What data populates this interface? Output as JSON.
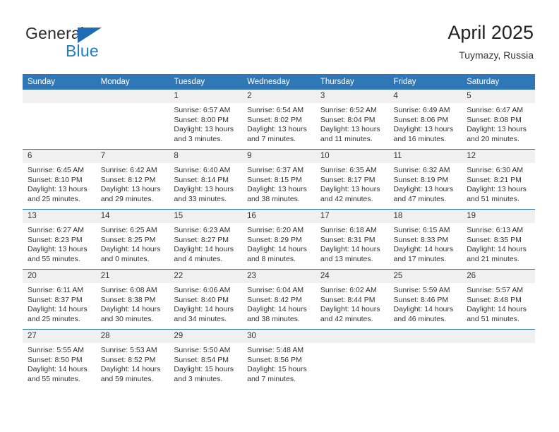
{
  "brand": {
    "name_top": "General",
    "name_bottom": "Blue",
    "triangle_icon": "blue-triangle-logo-mark",
    "accent_color": "#1f7ec4",
    "mark_color": "#1e6cb5"
  },
  "header": {
    "title": "April 2025",
    "subtitle": "Tuymazy, Russia"
  },
  "colors": {
    "header_blue": "#3077b8",
    "daynum_band": "#f0f0f0",
    "text": "#333333"
  },
  "weekday_headers": [
    "Sunday",
    "Monday",
    "Tuesday",
    "Wednesday",
    "Thursday",
    "Friday",
    "Saturday"
  ],
  "weeks": [
    [
      {
        "day": "",
        "lines": []
      },
      {
        "day": "",
        "lines": []
      },
      {
        "day": "1",
        "lines": [
          "Sunrise: 6:57 AM",
          "Sunset: 8:00 PM",
          "Daylight: 13 hours",
          "and 3 minutes."
        ]
      },
      {
        "day": "2",
        "lines": [
          "Sunrise: 6:54 AM",
          "Sunset: 8:02 PM",
          "Daylight: 13 hours",
          "and 7 minutes."
        ]
      },
      {
        "day": "3",
        "lines": [
          "Sunrise: 6:52 AM",
          "Sunset: 8:04 PM",
          "Daylight: 13 hours",
          "and 11 minutes."
        ]
      },
      {
        "day": "4",
        "lines": [
          "Sunrise: 6:49 AM",
          "Sunset: 8:06 PM",
          "Daylight: 13 hours",
          "and 16 minutes."
        ]
      },
      {
        "day": "5",
        "lines": [
          "Sunrise: 6:47 AM",
          "Sunset: 8:08 PM",
          "Daylight: 13 hours",
          "and 20 minutes."
        ]
      }
    ],
    [
      {
        "day": "6",
        "lines": [
          "Sunrise: 6:45 AM",
          "Sunset: 8:10 PM",
          "Daylight: 13 hours",
          "and 25 minutes."
        ]
      },
      {
        "day": "7",
        "lines": [
          "Sunrise: 6:42 AM",
          "Sunset: 8:12 PM",
          "Daylight: 13 hours",
          "and 29 minutes."
        ]
      },
      {
        "day": "8",
        "lines": [
          "Sunrise: 6:40 AM",
          "Sunset: 8:14 PM",
          "Daylight: 13 hours",
          "and 33 minutes."
        ]
      },
      {
        "day": "9",
        "lines": [
          "Sunrise: 6:37 AM",
          "Sunset: 8:15 PM",
          "Daylight: 13 hours",
          "and 38 minutes."
        ]
      },
      {
        "day": "10",
        "lines": [
          "Sunrise: 6:35 AM",
          "Sunset: 8:17 PM",
          "Daylight: 13 hours",
          "and 42 minutes."
        ]
      },
      {
        "day": "11",
        "lines": [
          "Sunrise: 6:32 AM",
          "Sunset: 8:19 PM",
          "Daylight: 13 hours",
          "and 47 minutes."
        ]
      },
      {
        "day": "12",
        "lines": [
          "Sunrise: 6:30 AM",
          "Sunset: 8:21 PM",
          "Daylight: 13 hours",
          "and 51 minutes."
        ]
      }
    ],
    [
      {
        "day": "13",
        "lines": [
          "Sunrise: 6:27 AM",
          "Sunset: 8:23 PM",
          "Daylight: 13 hours",
          "and 55 minutes."
        ]
      },
      {
        "day": "14",
        "lines": [
          "Sunrise: 6:25 AM",
          "Sunset: 8:25 PM",
          "Daylight: 14 hours",
          "and 0 minutes."
        ]
      },
      {
        "day": "15",
        "lines": [
          "Sunrise: 6:23 AM",
          "Sunset: 8:27 PM",
          "Daylight: 14 hours",
          "and 4 minutes."
        ]
      },
      {
        "day": "16",
        "lines": [
          "Sunrise: 6:20 AM",
          "Sunset: 8:29 PM",
          "Daylight: 14 hours",
          "and 8 minutes."
        ]
      },
      {
        "day": "17",
        "lines": [
          "Sunrise: 6:18 AM",
          "Sunset: 8:31 PM",
          "Daylight: 14 hours",
          "and 13 minutes."
        ]
      },
      {
        "day": "18",
        "lines": [
          "Sunrise: 6:15 AM",
          "Sunset: 8:33 PM",
          "Daylight: 14 hours",
          "and 17 minutes."
        ]
      },
      {
        "day": "19",
        "lines": [
          "Sunrise: 6:13 AM",
          "Sunset: 8:35 PM",
          "Daylight: 14 hours",
          "and 21 minutes."
        ]
      }
    ],
    [
      {
        "day": "20",
        "lines": [
          "Sunrise: 6:11 AM",
          "Sunset: 8:37 PM",
          "Daylight: 14 hours",
          "and 25 minutes."
        ]
      },
      {
        "day": "21",
        "lines": [
          "Sunrise: 6:08 AM",
          "Sunset: 8:38 PM",
          "Daylight: 14 hours",
          "and 30 minutes."
        ]
      },
      {
        "day": "22",
        "lines": [
          "Sunrise: 6:06 AM",
          "Sunset: 8:40 PM",
          "Daylight: 14 hours",
          "and 34 minutes."
        ]
      },
      {
        "day": "23",
        "lines": [
          "Sunrise: 6:04 AM",
          "Sunset: 8:42 PM",
          "Daylight: 14 hours",
          "and 38 minutes."
        ]
      },
      {
        "day": "24",
        "lines": [
          "Sunrise: 6:02 AM",
          "Sunset: 8:44 PM",
          "Daylight: 14 hours",
          "and 42 minutes."
        ]
      },
      {
        "day": "25",
        "lines": [
          "Sunrise: 5:59 AM",
          "Sunset: 8:46 PM",
          "Daylight: 14 hours",
          "and 46 minutes."
        ]
      },
      {
        "day": "26",
        "lines": [
          "Sunrise: 5:57 AM",
          "Sunset: 8:48 PM",
          "Daylight: 14 hours",
          "and 51 minutes."
        ]
      }
    ],
    [
      {
        "day": "27",
        "lines": [
          "Sunrise: 5:55 AM",
          "Sunset: 8:50 PM",
          "Daylight: 14 hours",
          "and 55 minutes."
        ]
      },
      {
        "day": "28",
        "lines": [
          "Sunrise: 5:53 AM",
          "Sunset: 8:52 PM",
          "Daylight: 14 hours",
          "and 59 minutes."
        ]
      },
      {
        "day": "29",
        "lines": [
          "Sunrise: 5:50 AM",
          "Sunset: 8:54 PM",
          "Daylight: 15 hours",
          "and 3 minutes."
        ]
      },
      {
        "day": "30",
        "lines": [
          "Sunrise: 5:48 AM",
          "Sunset: 8:56 PM",
          "Daylight: 15 hours",
          "and 7 minutes."
        ]
      },
      {
        "day": "",
        "lines": []
      },
      {
        "day": "",
        "lines": []
      },
      {
        "day": "",
        "lines": []
      }
    ]
  ]
}
